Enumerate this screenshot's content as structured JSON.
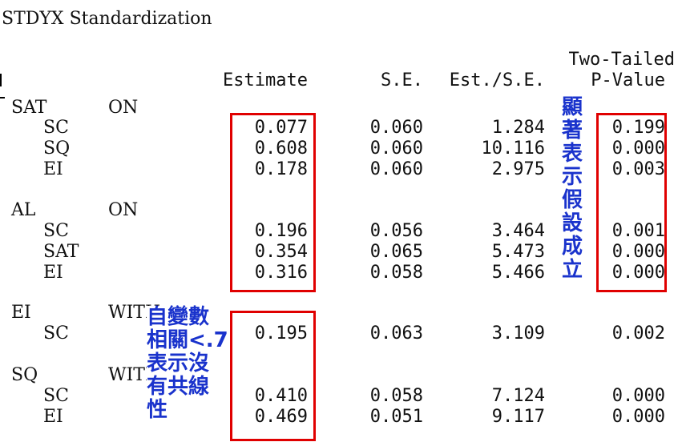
{
  "title": "STDYX Standardization",
  "headers": {
    "estimate": "Estimate",
    "se": "S.E.",
    "est_se": "Est./S.E.",
    "pvalue_line1": "Two-Tailed",
    "pvalue_line2": "P-Value"
  },
  "groups": [
    {
      "name": "SAT",
      "op": "ON",
      "rows": [
        {
          "var": "SC",
          "estimate": "0.077",
          "se": "0.060",
          "est_se": "1.284",
          "p": "0.199"
        },
        {
          "var": "SQ",
          "estimate": "0.608",
          "se": "0.060",
          "est_se": "10.116",
          "p": "0.000"
        },
        {
          "var": "EI",
          "estimate": "0.178",
          "se": "0.060",
          "est_se": "2.975",
          "p": "0.003"
        }
      ]
    },
    {
      "name": "AL",
      "op": "ON",
      "rows": [
        {
          "var": "SC",
          "estimate": "0.196",
          "se": "0.056",
          "est_se": "3.464",
          "p": "0.001"
        },
        {
          "var": "SAT",
          "estimate": "0.354",
          "se": "0.065",
          "est_se": "5.473",
          "p": "0.000"
        },
        {
          "var": "EI",
          "estimate": "0.316",
          "se": "0.058",
          "est_se": "5.466",
          "p": "0.000"
        }
      ]
    },
    {
      "name": "EI",
      "op": "WITH",
      "rows": [
        {
          "var": "SC",
          "estimate": "0.195",
          "se": "0.063",
          "est_se": "3.109",
          "p": "0.002"
        }
      ]
    },
    {
      "name": "SQ",
      "op": "WITH",
      "rows": [
        {
          "var": "SC",
          "estimate": "0.410",
          "se": "0.058",
          "est_se": "7.124",
          "p": "0.000"
        },
        {
          "var": "EI",
          "estimate": "0.469",
          "se": "0.051",
          "est_se": "9.117",
          "p": "0.000"
        }
      ]
    }
  ],
  "annotations": {
    "significance_note": "顯著表示假設成立",
    "collinearity_note_lines": [
      "自變數",
      "相關<.7",
      "表示沒",
      "有共線",
      "性"
    ]
  },
  "colors": {
    "highlight_box": "#e00000",
    "annotation_text": "#1a33cc"
  }
}
